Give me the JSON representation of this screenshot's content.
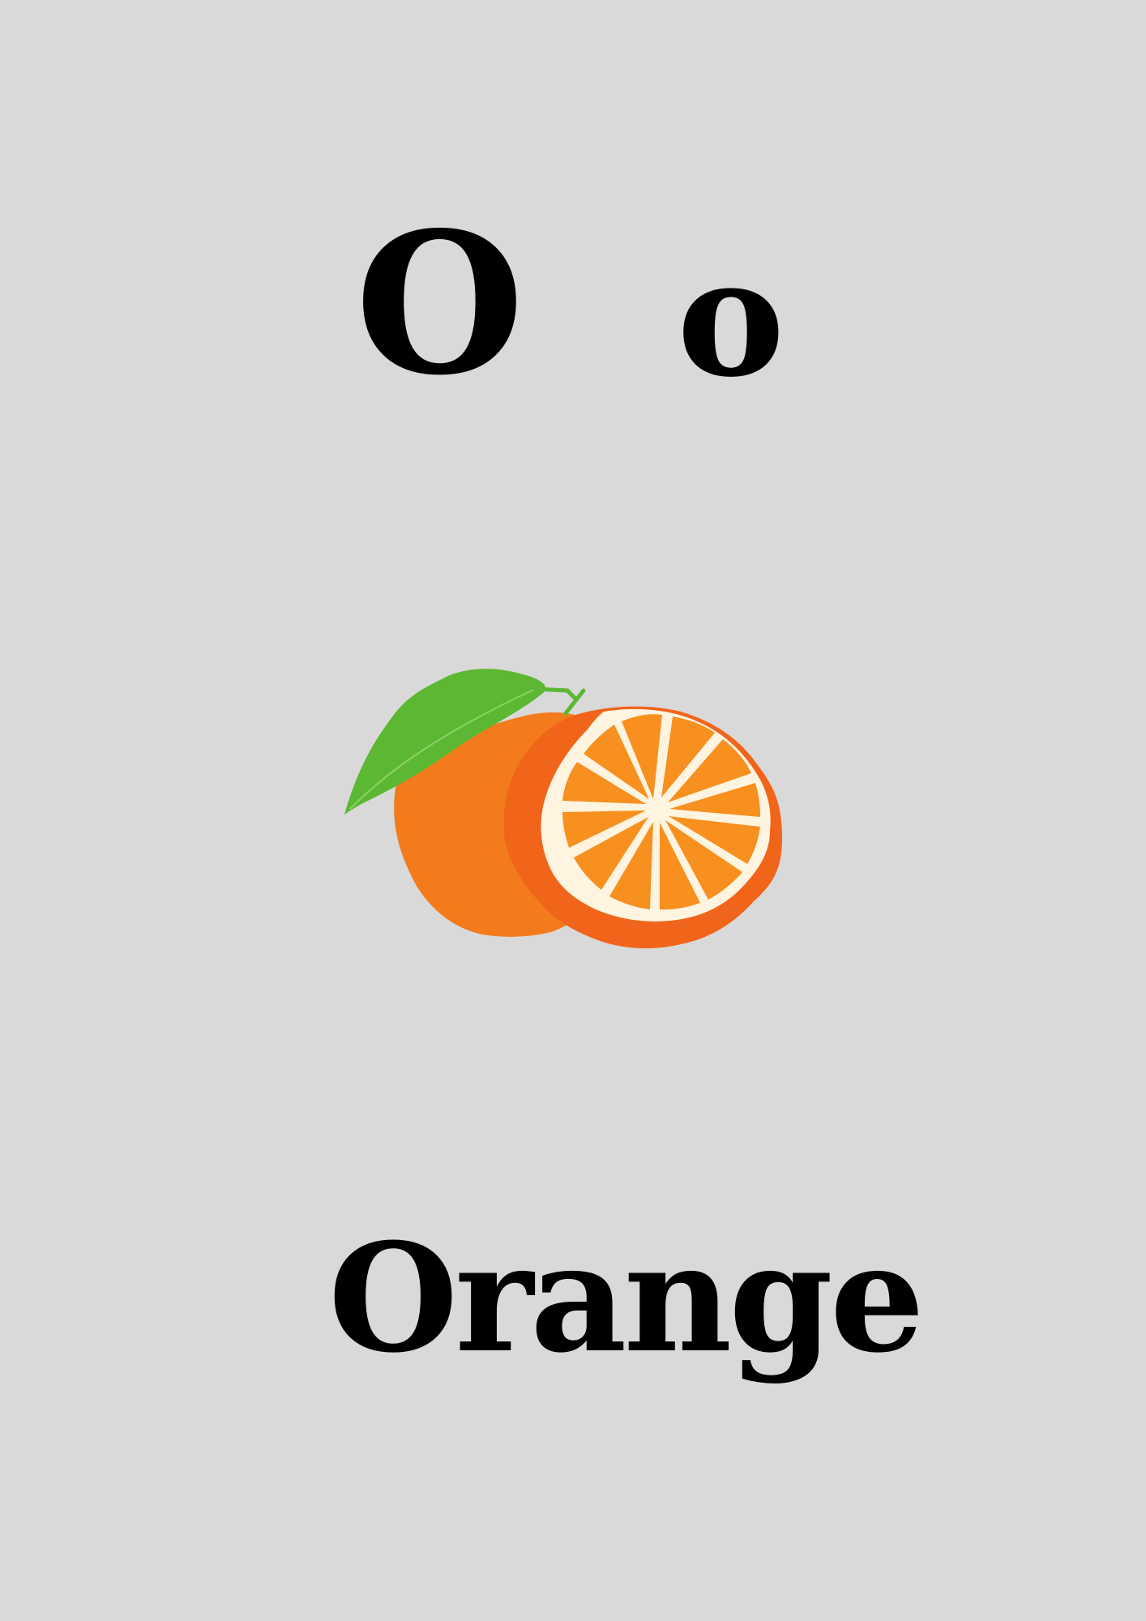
{
  "card": {
    "uppercase_letter": "O",
    "lowercase_letter": "o",
    "word": "Orange"
  },
  "illustration": {
    "subject_icon": "orange-fruit-icon",
    "colors": {
      "background": "#d9d9d9",
      "peel": "#f47b1c",
      "peel_dark": "#f1651b",
      "segment": "#f7901f",
      "pith": "#fff4e0",
      "leaf": "#5cb832",
      "text": "#000000"
    }
  }
}
